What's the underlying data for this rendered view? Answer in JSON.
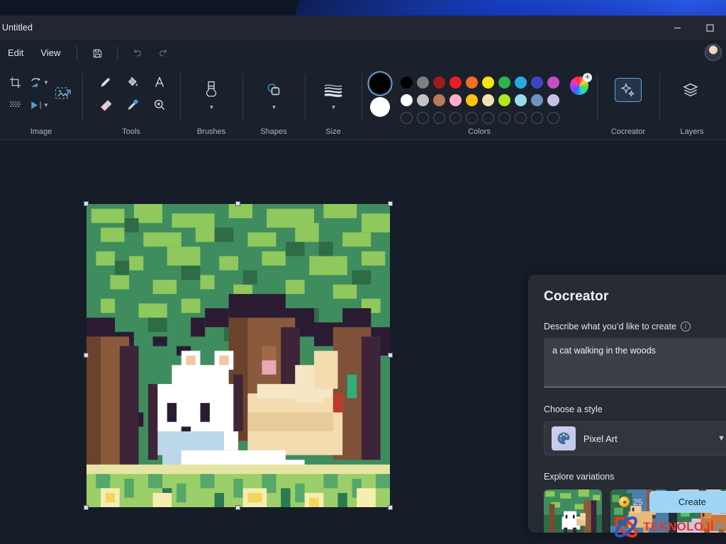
{
  "window": {
    "title": "- Untitled",
    "minimize_label": "–",
    "maximize_label": "☐",
    "avatar_name": "account-avatar"
  },
  "menubar": {
    "items": [
      {
        "label": "Edit",
        "name": "menu-edit"
      },
      {
        "label": "View",
        "name": "menu-view"
      }
    ],
    "icons": [
      {
        "label": "💾",
        "name": "save-icon"
      },
      {
        "label": "↶",
        "name": "undo-icon"
      },
      {
        "label": "↷",
        "name": "redo-icon"
      }
    ]
  },
  "ribbon": {
    "groups": [
      {
        "label": "Image",
        "name": "ribbon-group-image",
        "tools": [
          {
            "name": "crop-icon",
            "glyph": "⌧"
          },
          {
            "name": "rotate-icon",
            "glyph": "⟳",
            "caret": true
          },
          {
            "name": "select-rectangle-icon",
            "glyph": "⬚"
          },
          {
            "name": "transparent-selection-icon",
            "glyph": "░"
          },
          {
            "name": "flip-icon",
            "glyph": "▶",
            "caret": true
          }
        ]
      },
      {
        "label": "Tools",
        "name": "ribbon-group-tools",
        "tools": [
          {
            "name": "pencil-icon",
            "glyph": "✎"
          },
          {
            "name": "fill-bucket-icon",
            "glyph": "🪣"
          },
          {
            "name": "text-icon",
            "glyph": "A"
          },
          {
            "name": "eraser-icon",
            "glyph": "◆"
          },
          {
            "name": "eyedropper-icon",
            "glyph": "✐"
          },
          {
            "name": "magnifier-icon",
            "glyph": "⌕"
          }
        ]
      },
      {
        "label": "Brushes",
        "name": "ribbon-group-brushes"
      },
      {
        "label": "Shapes",
        "name": "ribbon-group-shapes"
      },
      {
        "label": "Size",
        "name": "ribbon-group-size"
      },
      {
        "label": "Colors",
        "name": "ribbon-group-colors"
      },
      {
        "label": "Cocreator",
        "name": "ribbon-group-cocreator"
      },
      {
        "label": "Layers",
        "name": "ribbon-group-layers"
      }
    ]
  },
  "colors": {
    "primary": "#000000",
    "secondary": "#ffffff",
    "row1": [
      "#000000",
      "#7f7f7f",
      "#a01c1c",
      "#ed1c24",
      "#f07020",
      "#f4e515",
      "#2ab648",
      "#29a8e0",
      "#3b47c8",
      "#c24fc8"
    ],
    "row2": [
      "#ffffff",
      "#c3c3c3",
      "#b97a57",
      "#ffaec9",
      "#ffc20e",
      "#efe4b0",
      "#b5e61d",
      "#99d9ea",
      "#7092be",
      "#c8bfe7"
    ],
    "row3_empty_count": 10,
    "wheel_name": "edit-colors-wheel"
  },
  "cocreator": {
    "title": "Cocreator",
    "prompt_label": "Describe what you’d like to create",
    "prompt_value": "a cat walking in the woods",
    "prompt_placeholder": "Describe what you’d like to create",
    "style_label": "Choose a style",
    "style_selected": "Pixel Art",
    "style_icon": "🎨",
    "variations_label": "Explore variations",
    "variations": [
      {
        "name": "variation-thumbnail-1"
      },
      {
        "name": "variation-thumbnail-2"
      },
      {
        "name": "variation-thumbnail-3"
      }
    ],
    "credits": "25",
    "create_label": "Create"
  },
  "canvas": {
    "name": "image-canvas",
    "selection_active": true
  },
  "watermark": {
    "text": "TEKNOLOJİ",
    "tail": "⇄"
  }
}
